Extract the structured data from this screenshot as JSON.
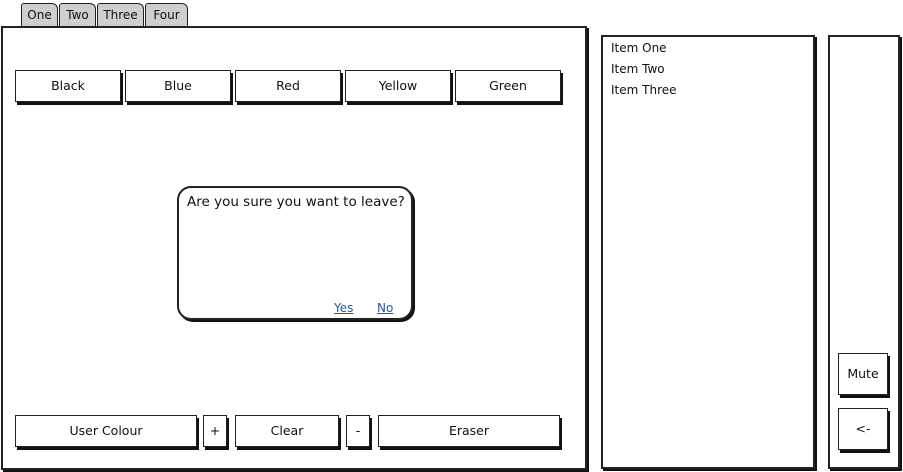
{
  "tabs": [
    {
      "label": "One"
    },
    {
      "label": "Two"
    },
    {
      "label": "Three"
    },
    {
      "label": "Four"
    }
  ],
  "colour_buttons": [
    "Black",
    "Blue",
    "Red",
    "Yellow",
    "Green"
  ],
  "dialog": {
    "message": "Are you sure you want to leave?",
    "yes": "Yes",
    "no": "No"
  },
  "bottom_toolbar": {
    "user_colour": "User Colour",
    "plus": "+",
    "clear": "Clear",
    "minus": "-",
    "eraser": "Eraser"
  },
  "list": {
    "items": [
      "Item One",
      "Item Two",
      "Item Three"
    ]
  },
  "side": {
    "mute": "Mute",
    "back": "<-"
  },
  "colors": {
    "tab_bg": "#cfcfcf",
    "link": "#1a5aa6"
  }
}
